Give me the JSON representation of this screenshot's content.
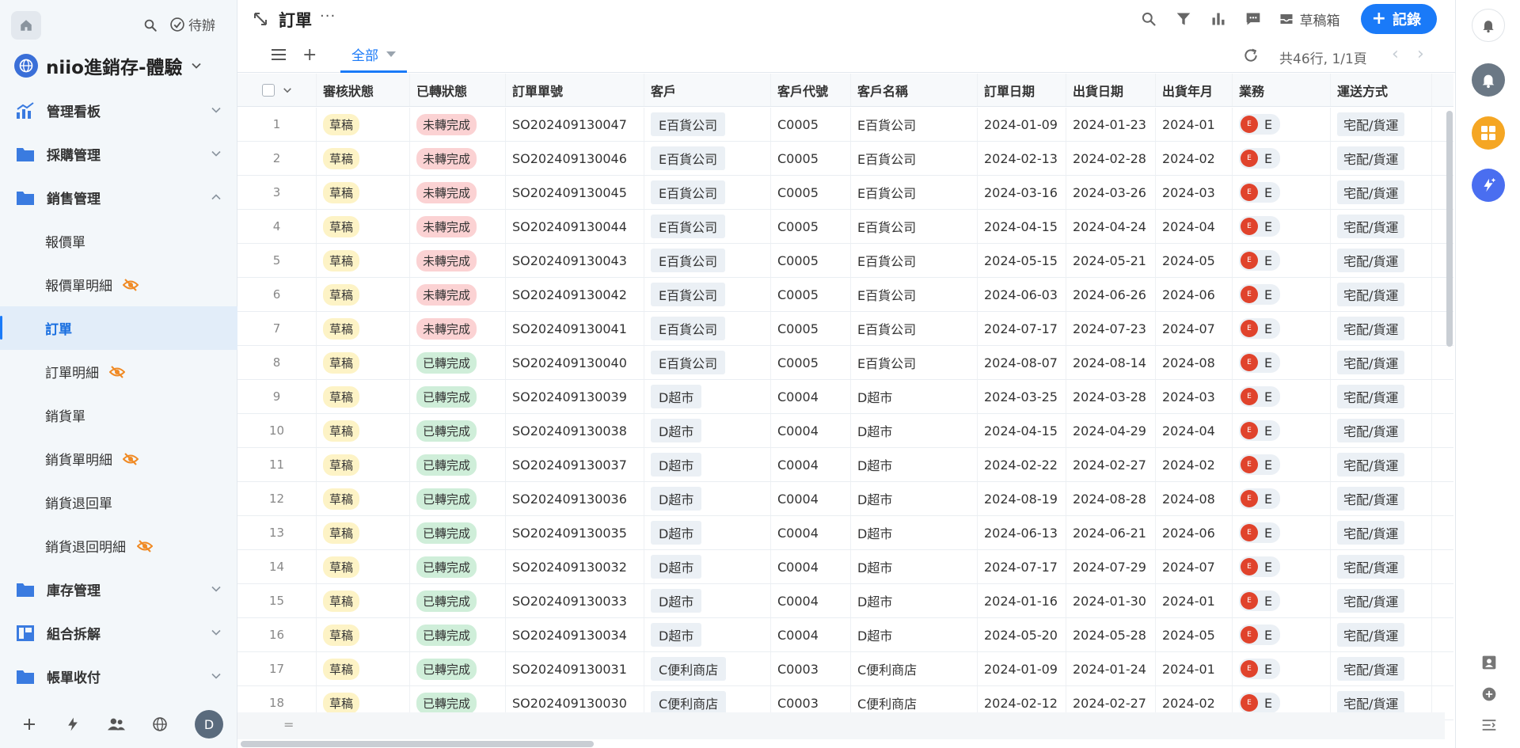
{
  "sidebar": {
    "todo_label": "待辦",
    "workspace_name": "niio進銷存-體驗",
    "sections": [
      {
        "label": "管理看板",
        "icon": "chart-icon"
      },
      {
        "label": "採購管理",
        "icon": "folder-icon"
      },
      {
        "label": "銷售管理",
        "icon": "folder-icon"
      },
      {
        "label": "庫存管理",
        "icon": "folder-icon"
      },
      {
        "label": "組合拆解",
        "icon": "dashboard-icon"
      },
      {
        "label": "帳單收付",
        "icon": "folder-icon"
      }
    ],
    "sales_items": [
      {
        "label": "報價單",
        "hidden": false
      },
      {
        "label": "報價單明細",
        "hidden": true
      },
      {
        "label": "訂單",
        "hidden": false,
        "active": true
      },
      {
        "label": "訂單明細",
        "hidden": true
      },
      {
        "label": "銷貨單",
        "hidden": false
      },
      {
        "label": "銷貨單明細",
        "hidden": true
      },
      {
        "label": "銷貨退回單",
        "hidden": false
      },
      {
        "label": "銷貨退回明細",
        "hidden": true
      }
    ],
    "avatar_initial": "D"
  },
  "header": {
    "title": "訂單",
    "drafts_label": "草稿箱",
    "add_record_label": "記錄"
  },
  "viewbar": {
    "tab_label": "全部",
    "count_label": "共46行, 1/1頁"
  },
  "table": {
    "columns": [
      "審核狀態",
      "已轉狀態",
      "訂單單號",
      "客戶",
      "客戶代號",
      "客戶名稱",
      "訂單日期",
      "出貨日期",
      "出貨年月",
      "業務",
      "運送方式"
    ],
    "rows": [
      [
        "1",
        "草稿",
        "未轉完成",
        "SO202409130047",
        "E百貨公司",
        "C0005",
        "E百貨公司",
        "2024-01-09",
        "2024-01-23",
        "2024-01",
        "E",
        "宅配/貨運"
      ],
      [
        "2",
        "草稿",
        "未轉完成",
        "SO202409130046",
        "E百貨公司",
        "C0005",
        "E百貨公司",
        "2024-02-13",
        "2024-02-28",
        "2024-02",
        "E",
        "宅配/貨運"
      ],
      [
        "3",
        "草稿",
        "未轉完成",
        "SO202409130045",
        "E百貨公司",
        "C0005",
        "E百貨公司",
        "2024-03-16",
        "2024-03-26",
        "2024-03",
        "E",
        "宅配/貨運"
      ],
      [
        "4",
        "草稿",
        "未轉完成",
        "SO202409130044",
        "E百貨公司",
        "C0005",
        "E百貨公司",
        "2024-04-15",
        "2024-04-24",
        "2024-04",
        "E",
        "宅配/貨運"
      ],
      [
        "5",
        "草稿",
        "未轉完成",
        "SO202409130043",
        "E百貨公司",
        "C0005",
        "E百貨公司",
        "2024-05-15",
        "2024-05-21",
        "2024-05",
        "E",
        "宅配/貨運"
      ],
      [
        "6",
        "草稿",
        "未轉完成",
        "SO202409130042",
        "E百貨公司",
        "C0005",
        "E百貨公司",
        "2024-06-03",
        "2024-06-26",
        "2024-06",
        "E",
        "宅配/貨運"
      ],
      [
        "7",
        "草稿",
        "未轉完成",
        "SO202409130041",
        "E百貨公司",
        "C0005",
        "E百貨公司",
        "2024-07-17",
        "2024-07-23",
        "2024-07",
        "E",
        "宅配/貨運"
      ],
      [
        "8",
        "草稿",
        "已轉完成",
        "SO202409130040",
        "E百貨公司",
        "C0005",
        "E百貨公司",
        "2024-08-07",
        "2024-08-14",
        "2024-08",
        "E",
        "宅配/貨運"
      ],
      [
        "9",
        "草稿",
        "已轉完成",
        "SO202409130039",
        "D超市",
        "C0004",
        "D超市",
        "2024-03-25",
        "2024-03-28",
        "2024-03",
        "E",
        "宅配/貨運"
      ],
      [
        "10",
        "草稿",
        "已轉完成",
        "SO202409130038",
        "D超市",
        "C0004",
        "D超市",
        "2024-04-15",
        "2024-04-29",
        "2024-04",
        "E",
        "宅配/貨運"
      ],
      [
        "11",
        "草稿",
        "已轉完成",
        "SO202409130037",
        "D超市",
        "C0004",
        "D超市",
        "2024-02-22",
        "2024-02-27",
        "2024-02",
        "E",
        "宅配/貨運"
      ],
      [
        "12",
        "草稿",
        "已轉完成",
        "SO202409130036",
        "D超市",
        "C0004",
        "D超市",
        "2024-08-19",
        "2024-08-28",
        "2024-08",
        "E",
        "宅配/貨運"
      ],
      [
        "13",
        "草稿",
        "已轉完成",
        "SO202409130035",
        "D超市",
        "C0004",
        "D超市",
        "2024-06-13",
        "2024-06-21",
        "2024-06",
        "E",
        "宅配/貨運"
      ],
      [
        "14",
        "草稿",
        "已轉完成",
        "SO202409130032",
        "D超市",
        "C0004",
        "D超市",
        "2024-07-17",
        "2024-07-29",
        "2024-07",
        "E",
        "宅配/貨運"
      ],
      [
        "15",
        "草稿",
        "已轉完成",
        "SO202409130033",
        "D超市",
        "C0004",
        "D超市",
        "2024-01-16",
        "2024-01-30",
        "2024-01",
        "E",
        "宅配/貨運"
      ],
      [
        "16",
        "草稿",
        "已轉完成",
        "SO202409130034",
        "D超市",
        "C0004",
        "D超市",
        "2024-05-20",
        "2024-05-28",
        "2024-05",
        "E",
        "宅配/貨運"
      ],
      [
        "17",
        "草稿",
        "已轉完成",
        "SO202409130031",
        "C便利商店",
        "C0003",
        "C便利商店",
        "2024-01-09",
        "2024-01-24",
        "2024-01",
        "E",
        "宅配/貨運"
      ],
      [
        "18",
        "草稿",
        "已轉完成",
        "SO202409130030",
        "C便利商店",
        "C0003",
        "C便利商店",
        "2024-02-12",
        "2024-02-27",
        "2024-02",
        "E",
        "宅配/貨運"
      ]
    ],
    "footer_symbol": "="
  },
  "colors": {
    "accent": "#1a7af8",
    "draft_tag": "#fdf3c6",
    "not_done_tag": "#fbd2d3",
    "done_tag": "#cfeed9",
    "avatar_red": "#e0432c",
    "rail_orange": "#f5a623",
    "rail_blue": "#4a6ef0",
    "rail_gray": "#6b7885"
  }
}
